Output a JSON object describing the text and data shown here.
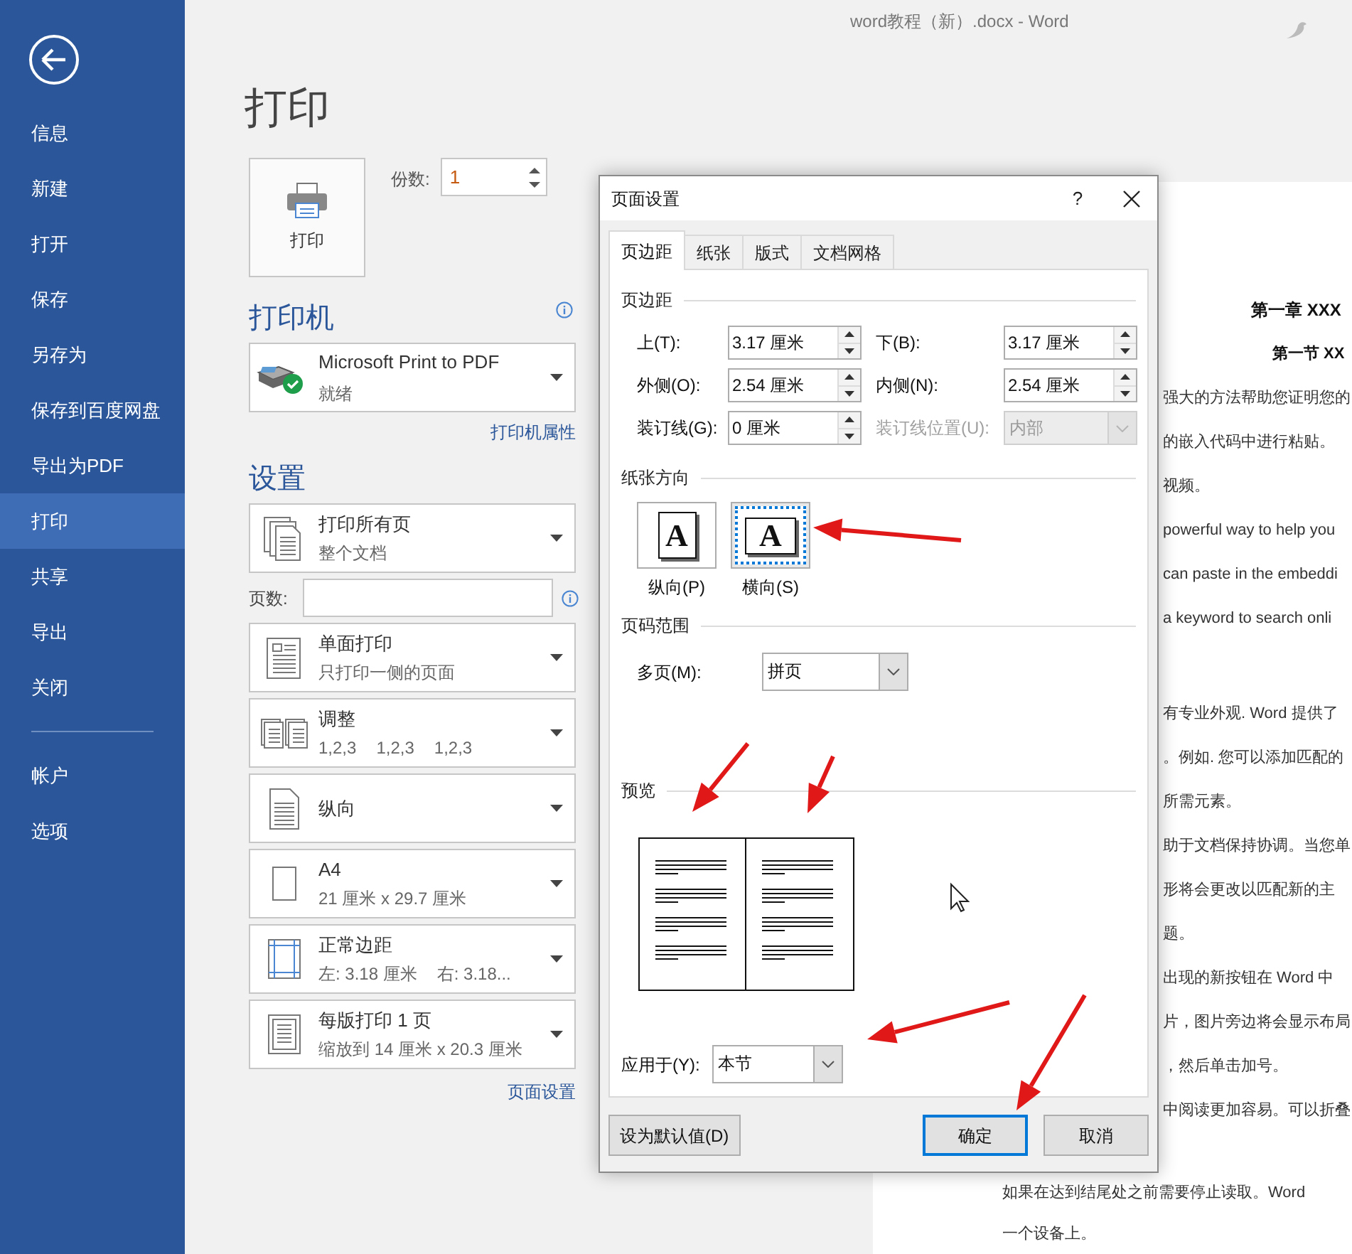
{
  "window": {
    "title": "word教程（新）.docx - Word"
  },
  "sidebar": {
    "items": [
      {
        "label": "信息",
        "selected": false
      },
      {
        "label": "新建",
        "selected": false
      },
      {
        "label": "打开",
        "selected": false
      },
      {
        "label": "保存",
        "selected": false
      },
      {
        "label": "另存为",
        "selected": false
      },
      {
        "label": "保存到百度网盘",
        "selected": false
      },
      {
        "label": "导出为PDF",
        "selected": false
      },
      {
        "label": "打印",
        "selected": true
      },
      {
        "label": "共享",
        "selected": false
      },
      {
        "label": "导出",
        "selected": false
      },
      {
        "label": "关闭",
        "selected": false
      }
    ],
    "footer_items": [
      {
        "label": "帐户",
        "selected": false
      },
      {
        "label": "选项",
        "selected": false
      }
    ]
  },
  "print": {
    "heading": "打印",
    "button": "打印",
    "copies_label": "份数:",
    "copies_value": "1"
  },
  "printer": {
    "heading": "打印机",
    "name": "Microsoft Print to PDF",
    "status": "就绪",
    "properties_link": "打印机属性"
  },
  "settings": {
    "heading": "设置",
    "options": [
      {
        "kind": "pages",
        "title": "打印所有页",
        "subtitle_parts": [
          "整个文档"
        ]
      },
      {
        "kind": "pages_field",
        "label": "页数:"
      },
      {
        "kind": "one_sided",
        "title": "单面打印",
        "subtitle_parts": [
          "只打印一侧的页面"
        ]
      },
      {
        "kind": "collate",
        "title": "调整",
        "subtitle_parts": [
          "1,2,3",
          "1,2,3",
          "1,2,3"
        ]
      },
      {
        "kind": "portrait",
        "title": "纵向"
      },
      {
        "kind": "paper",
        "title": "A4",
        "subtitle_parts": [
          "21 厘米 x 29.7 厘米"
        ]
      },
      {
        "kind": "margins",
        "title": "正常边距",
        "subtitle_parts": [
          "左: 3.18 厘米",
          "右: 3.18..."
        ]
      },
      {
        "kind": "per_sheet",
        "title": "每版打印 1 页",
        "subtitle_parts": [
          "缩放到 14 厘米 x 20.3 厘米"
        ]
      }
    ],
    "page_setup_link": "页面设置"
  },
  "document": {
    "paragraphs": [
      {
        "lines": [
          {
            "kind": "heading1",
            "text": "第一章 XXX"
          },
          {
            "kind": "heading2",
            "text": "第一节 XX"
          },
          {
            "kind": "right",
            "text": "强大的方法帮助您证明您的"
          },
          {
            "kind": "right",
            "text": "的嵌入代码中进行粘贴。"
          },
          {
            "kind": "right",
            "text": "视频。"
          },
          {
            "kind": "right",
            "text": "powerful way to help you"
          },
          {
            "kind": "right",
            "text": "can paste in the embeddi"
          },
          {
            "kind": "right",
            "text": "a keyword to search onli"
          }
        ]
      },
      {
        "lines": [
          {
            "kind": "right",
            "text": "有专业外观. Word 提供了"
          },
          {
            "kind": "right",
            "text": "。例如. 您可以添加匹配的"
          },
          {
            "kind": "right",
            "text": "所需元素。"
          },
          {
            "kind": "right",
            "text": "助于文档保持协调。当您单"
          },
          {
            "kind": "right",
            "text": "形将会更改以匹配新的主"
          },
          {
            "kind": "right",
            "text": "题。"
          },
          {
            "kind": "right",
            "text": "出现的新按钮在 Word 中"
          },
          {
            "kind": "right",
            "text": "片，图片旁边将会显示布局"
          },
          {
            "kind": "right",
            "text": "，然后单击加号。"
          },
          {
            "kind": "right",
            "text": "中阅读更加容易。可以折叠"
          }
        ]
      },
      {
        "lines": [
          {
            "kind": "full",
            "text": "如果在达到结尾处之前需要停止读取。Word"
          },
          {
            "kind": "full",
            "text": "一个设备上。"
          }
        ]
      }
    ]
  },
  "dialog": {
    "title": "页面设置",
    "help": "?",
    "tabs": [
      {
        "label": "页边距",
        "selected": true
      },
      {
        "label": "纸张",
        "selected": false
      },
      {
        "label": "版式",
        "selected": false
      },
      {
        "label": "文档网格",
        "selected": false
      }
    ],
    "margins_section": "页边距",
    "margin_fields": [
      {
        "kind": "spin",
        "label": "上(T):",
        "value": "3.17 厘米",
        "disabled": false
      },
      {
        "kind": "spin",
        "label": "下(B):",
        "value": "3.17 厘米",
        "disabled": false
      },
      {
        "kind": "spin",
        "label": "外侧(O):",
        "value": "2.54 厘米",
        "disabled": false
      },
      {
        "kind": "spin",
        "label": "内侧(N):",
        "value": "2.54 厘米",
        "disabled": false
      },
      {
        "kind": "spin",
        "label": "装订线(G):",
        "value": "0 厘米",
        "disabled": false
      },
      {
        "kind": "select",
        "label": "装订线位置(U):",
        "value": "内部",
        "disabled": true
      }
    ],
    "orientation_section": "纸张方向",
    "orientations": [
      {
        "kind": "portrait",
        "glyph": "A",
        "label": "纵向(P)",
        "selected": false
      },
      {
        "kind": "landscape",
        "glyph": "A",
        "label": "横向(S)",
        "selected": true
      }
    ],
    "pages_section": "页码范围",
    "multiple_pages": {
      "label": "多页(M):",
      "value": "拼页"
    },
    "preview_section": "预览",
    "apply_to": {
      "label": "应用于(Y):",
      "value": "本节"
    },
    "buttons": [
      {
        "label": "设为默认值(D)",
        "default": false
      },
      {
        "label": "确定",
        "default": true
      },
      {
        "label": "取消",
        "default": false
      }
    ]
  }
}
